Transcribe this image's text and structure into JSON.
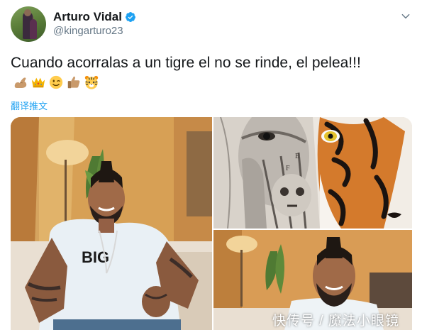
{
  "user": {
    "display_name": "Arturo Vidal",
    "handle": "@kingarturo23",
    "verified_icon": "verified-badge-icon",
    "verified_color": "#1da1f2"
  },
  "tweet": {
    "text": "Cuando acorralas a un tigre el no se rinde, el pelea!!!",
    "emojis": [
      "flexed-biceps-emoji",
      "crown-emoji",
      "winking-face-emoji",
      "thumbs-up-emoji",
      "tiger-face-emoji"
    ],
    "translate_label": "翻译推文"
  },
  "media": {
    "count": 3,
    "watermark": "快传号 / 魔法小眼镜"
  },
  "colors": {
    "text": "#14171a",
    "secondary": "#657786",
    "link": "#1da1f2"
  }
}
